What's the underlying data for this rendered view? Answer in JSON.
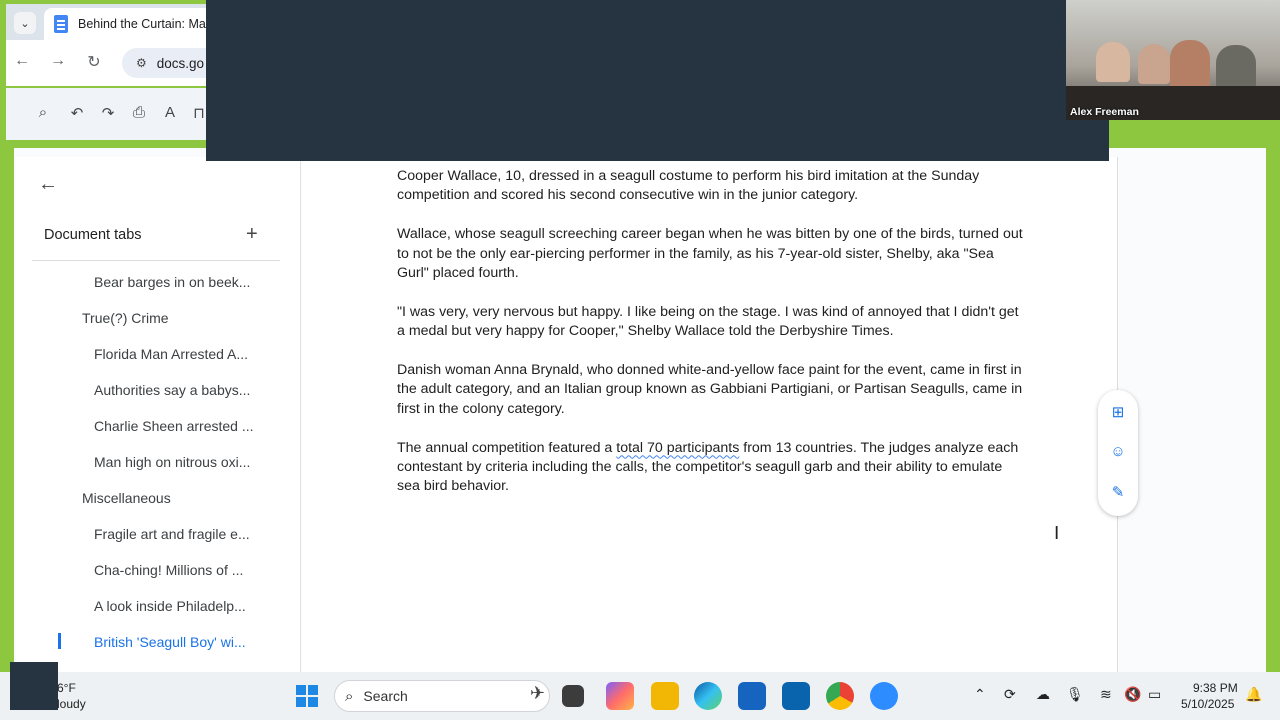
{
  "browser": {
    "tab_title": "Behind the Curtain: May",
    "url": "docs.go"
  },
  "video": {
    "participant_name": "Alex Freeman"
  },
  "sidebar": {
    "header": "Document tabs",
    "add_symbol": "+",
    "items": [
      {
        "label": "Bear barges in on beek...",
        "level": "child"
      },
      {
        "label": "True(?) Crime",
        "level": "parent"
      },
      {
        "label": "Florida Man Arrested A...",
        "level": "child"
      },
      {
        "label": "Authorities say a babys...",
        "level": "child"
      },
      {
        "label": "Charlie Sheen arrested ...",
        "level": "child"
      },
      {
        "label": "Man high on nitrous oxi...",
        "level": "child"
      },
      {
        "label": "Miscellaneous",
        "level": "parent"
      },
      {
        "label": "Fragile art and fragile e...",
        "level": "child"
      },
      {
        "label": "Cha-ching! Millions of ...",
        "level": "child"
      },
      {
        "label": "A look inside Philadelp...",
        "level": "child"
      },
      {
        "label": "British 'Seagull Boy' wi...",
        "level": "child",
        "active": true
      }
    ]
  },
  "document": {
    "paragraphs": [
      {
        "text": "Cooper Wallace, 10, dressed in a seagull costume to perform his bird imitation at the Sunday competition and scored his second consecutive win in the junior category."
      },
      {
        "text": "Wallace, whose seagull screeching career began when he was bitten by one of the birds, turned out to not be the only ear-piercing performer in the family, as his 7-year-old sister, Shelby, aka \"Sea Gurl\" placed fourth."
      },
      {
        "text": "\"I was very, very nervous but happy. I like being on the stage. I was kind of annoyed that I didn't get a medal but very happy for Cooper,\" Shelby Wallace told the Derbyshire Times."
      },
      {
        "text": "Danish woman Anna Brynald, who donned white-and-yellow face paint for the event, came in first in the adult category, and an Italian group known as Gabbiani Partigiani, or Partisan Seagulls, came in first in the colony category."
      }
    ],
    "last_paragraph": {
      "before": "The annual competition featured a ",
      "underlined": "total 70 participants",
      "after": " from 13 countries. The judges analyze each contestant by criteria including the calls, the competitor's seagull garb and their ability to emulate sea bird behavior."
    }
  },
  "taskbar": {
    "weather_temp": "6°F",
    "weather_desc": "loudy",
    "search_label": "Search",
    "time": "9:38 PM",
    "date": "5/10/2025"
  },
  "colors": {
    "accent": "#1a73e8",
    "overlay": "#263340",
    "frame": "#8dc63f"
  }
}
